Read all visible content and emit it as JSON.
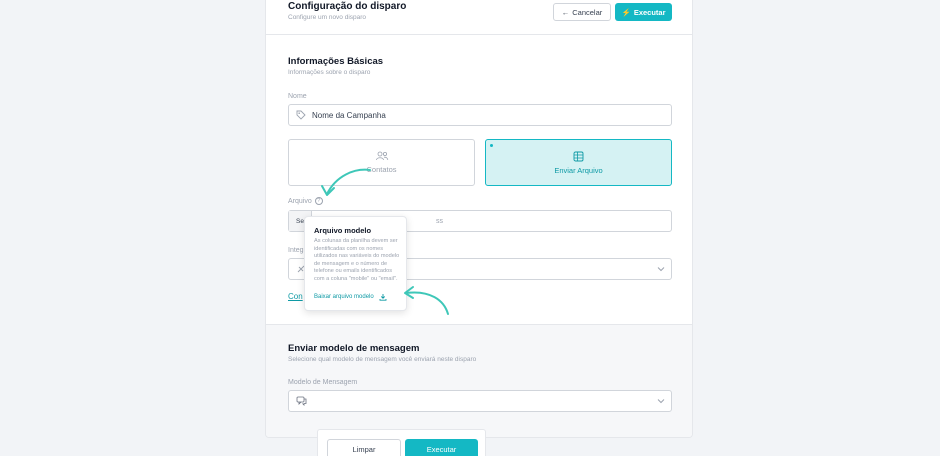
{
  "header": {
    "title": "Configuração do disparo",
    "subtitle": "Configure um novo disparo",
    "cancel_label": "Cancelar",
    "execute_label": "Executar"
  },
  "basic_info": {
    "title": "Informações Básicas",
    "subtitle": "Informações sobre o disparo",
    "name_label": "Nome",
    "name_placeholder": "Nome da Campanha",
    "options": [
      {
        "label": "Contatos",
        "icon": "users-icon",
        "selected": false
      },
      {
        "label": "Enviar Arquivo",
        "icon": "spreadsheet-icon",
        "selected": true
      }
    ],
    "file_label": "Arquivo",
    "file_button_partial": "Se",
    "file_placeholder_partial": "ss",
    "integration_label_partial": "Integ",
    "link_partial": "Con"
  },
  "tooltip": {
    "title": "Arquivo modelo",
    "body": "As colunas da planilha devem ser identificadas com os nomes utilizados nas variáveis do modelo de mensagem e o número de telefone ou emails identificados com a coluna \"mobile\" ou \"email\".",
    "download_label": "Baixar arquivo modelo"
  },
  "message_section": {
    "title": "Enviar modelo de mensagem",
    "subtitle": "Selecione qual modelo de mensagem você enviará neste disparo",
    "template_label": "Modelo de Mensagem"
  },
  "footer": {
    "clear_label": "Limpar",
    "execute_label": "Executar"
  },
  "colors": {
    "accent": "#14b8c4",
    "accent_light": "#d5f2f3",
    "arrow": "#3ec7b8"
  }
}
